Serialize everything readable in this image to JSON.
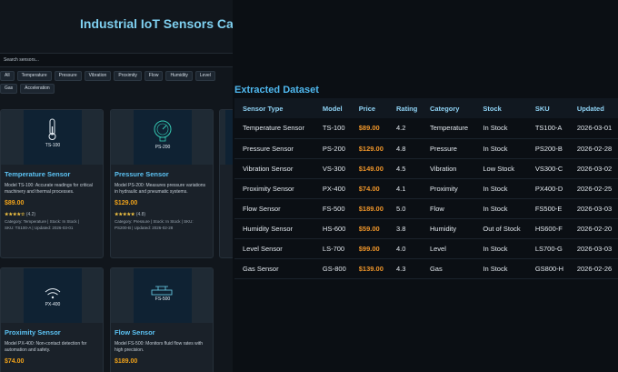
{
  "catalog": {
    "title": "Industrial IoT Sensors Catalog",
    "search_placeholder": "Search sensors...",
    "filters": [
      "All",
      "Temperature",
      "Pressure",
      "Vibration",
      "Proximity",
      "Flow",
      "Humidity",
      "Level",
      "Gas",
      "Acceleration"
    ],
    "cards": [
      {
        "code": "TS-100",
        "name": "Temperature Sensor",
        "desc": "Model TS-100: Accurate readings for critical machinery and thermal processes.",
        "price": "$89.00",
        "stars": "★★★★☆",
        "rating": "(4.2)",
        "meta1": "Category: Temperature | Stock: In Stock |",
        "meta2": "SKU: TS100-A | Updated: 2026-03-01",
        "icon": "thermometer-icon"
      },
      {
        "code": "PS-200",
        "name": "Pressure Sensor",
        "desc": "Model PS-200: Measures pressure variations in hydraulic and pneumatic systems.",
        "price": "$129.00",
        "stars": "★★★★★",
        "rating": "(4.8)",
        "meta1": "Category: Pressure | Stock: In Stock | SKU:",
        "meta2": "PS200-B | Updated: 2026-02-28",
        "icon": "gauge-icon"
      },
      {
        "code": "PX-400",
        "name": "Proximity Sensor",
        "desc": "Model PX-400: Non-contact detection for automation and safety.",
        "price": "$74.00",
        "icon": "wifi-icon"
      },
      {
        "code": "FS-500",
        "name": "Flow Sensor",
        "desc": "Model FS-500: Monitors fluid flow rates with high precision.",
        "price": "$189.00",
        "icon": "flow-icon"
      }
    ]
  },
  "dataset": {
    "title": "Extracted Dataset",
    "columns": [
      "Sensor Type",
      "Model",
      "Price",
      "Rating",
      "Category",
      "Stock",
      "SKU",
      "Updated"
    ],
    "rows": [
      [
        "Temperature Sensor",
        "TS-100",
        "$89.00",
        "4.2",
        "Temperature",
        "In Stock",
        "TS100-A",
        "2026-03-01"
      ],
      [
        "Pressure Sensor",
        "PS-200",
        "$129.00",
        "4.8",
        "Pressure",
        "In Stock",
        "PS200-B",
        "2026-02-28"
      ],
      [
        "Vibration Sensor",
        "VS-300",
        "$149.00",
        "4.5",
        "Vibration",
        "Low Stock",
        "VS300-C",
        "2026-03-02"
      ],
      [
        "Proximity Sensor",
        "PX-400",
        "$74.00",
        "4.1",
        "Proximity",
        "In Stock",
        "PX400-D",
        "2026-02-25"
      ],
      [
        "Flow Sensor",
        "FS-500",
        "$189.00",
        "5.0",
        "Flow",
        "In Stock",
        "FS500-E",
        "2026-03-03"
      ],
      [
        "Humidity Sensor",
        "HS-600",
        "$59.00",
        "3.8",
        "Humidity",
        "Out of Stock",
        "HS600-F",
        "2026-02-20"
      ],
      [
        "Level Sensor",
        "LS-700",
        "$99.00",
        "4.0",
        "Level",
        "In Stock",
        "LS700-G",
        "2026-03-03"
      ],
      [
        "Gas Sensor",
        "GS-800",
        "$139.00",
        "4.3",
        "Gas",
        "In Stock",
        "GS800-H",
        "2026-02-26"
      ]
    ]
  }
}
